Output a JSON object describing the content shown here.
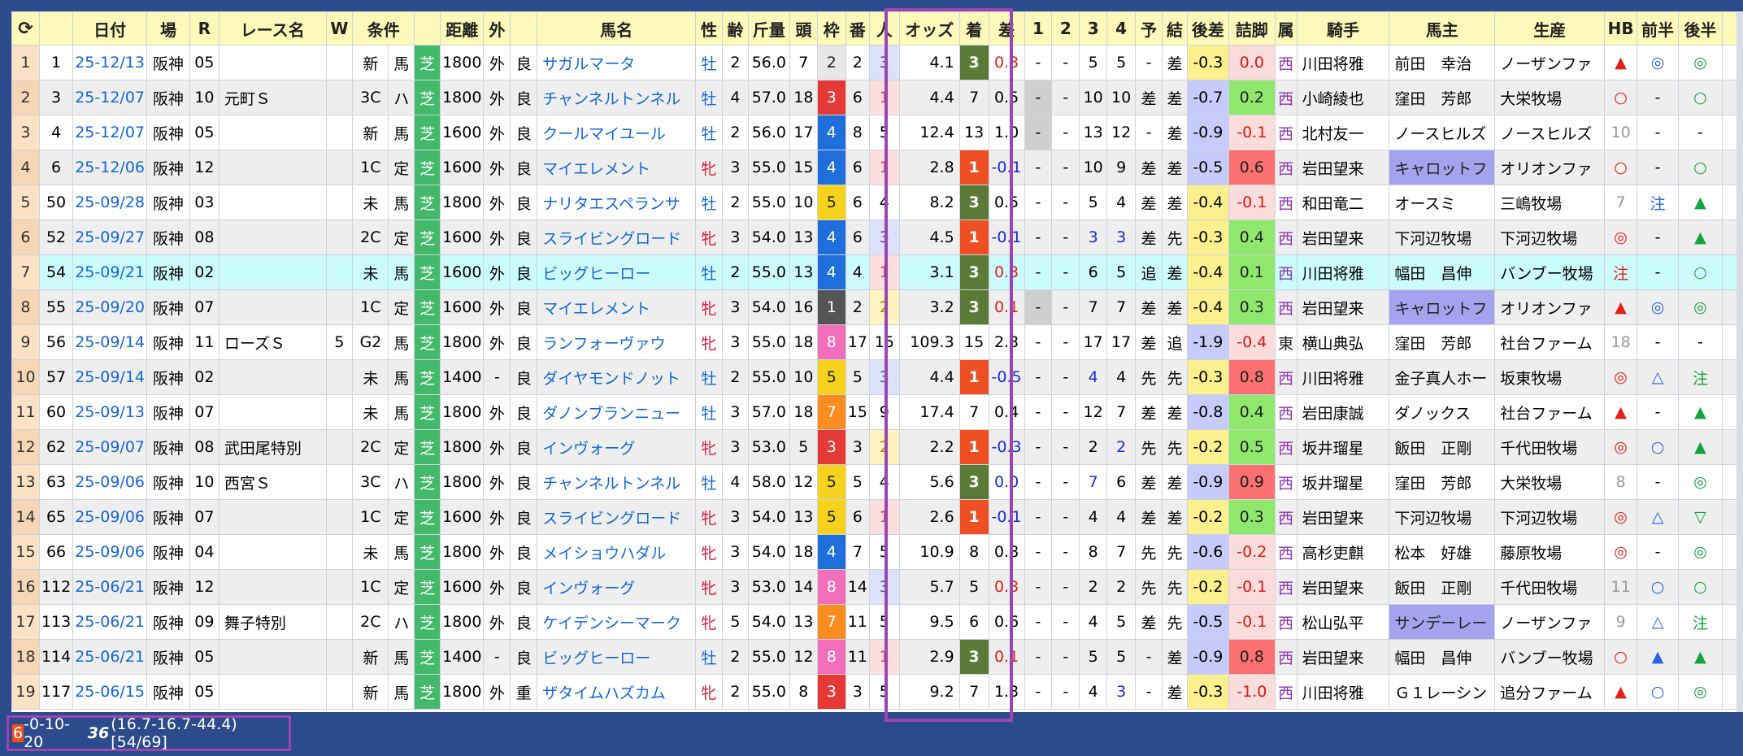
{
  "headers": [
    "",
    "日付",
    "場",
    "R",
    "レース名",
    "W",
    "条件",
    "",
    "",
    "距離",
    "外",
    "",
    "馬名",
    "性",
    "齢",
    "斤量",
    "頭",
    "枠",
    "番",
    "人",
    "オッズ",
    "着",
    "差",
    "1",
    "2",
    "3",
    "4",
    "予",
    "結",
    "後差",
    "詰脚",
    "属",
    "騎手",
    "馬主",
    "生産",
    "HB",
    "前半",
    "後半"
  ],
  "rows": [
    {
      "no": "1",
      "id": "1",
      "date": "25-12/13",
      "venue": "阪神",
      "r": "05",
      "name": "",
      "w": "",
      "cls": "新",
      "type": "馬",
      "surf": "芝",
      "dist": "1800",
      "course": "外",
      "cond": "良",
      "horse": "サガルマータ",
      "sex": "牡",
      "age": "2",
      "wt": "56.0",
      "heads": "7",
      "frame": "2",
      "num": "2",
      "pop": "3",
      "odds": "4.1",
      "fin": "3",
      "diff": "0.3",
      "c1": "-",
      "c2": "-",
      "c3": "5",
      "c4": "5",
      "pred": "-",
      "res": "差",
      "late": "-0.3",
      "sprint": "0.0",
      "aff": "西",
      "jockey": "川田将雅",
      "owner": "前田　幸治",
      "breeder": "ノーザンファ",
      "hb": "▲",
      "fh": "◎",
      "sh": "◎"
    },
    {
      "no": "2",
      "id": "3",
      "date": "25-12/07",
      "venue": "阪神",
      "r": "10",
      "name": "元町Ｓ",
      "w": "",
      "cls": "3C",
      "type": "ハ",
      "surf": "芝",
      "dist": "1800",
      "course": "外",
      "cond": "良",
      "horse": "チャンネルトンネル",
      "sex": "牡",
      "age": "4",
      "wt": "57.0",
      "heads": "18",
      "frame": "3",
      "num": "6",
      "pop": "1",
      "odds": "4.4",
      "fin": "7",
      "diff": "0.5",
      "c1": "-",
      "c2": "-",
      "c3": "10",
      "c4": "10",
      "pred": "差",
      "res": "差",
      "late": "-0.7",
      "sprint": "0.2",
      "aff": "西",
      "jockey": "小崎綾也",
      "owner": "窪田　芳郎",
      "breeder": "大栄牧場",
      "hb": "○",
      "fh": "-",
      "sh": "○"
    },
    {
      "no": "3",
      "id": "4",
      "date": "25-12/07",
      "venue": "阪神",
      "r": "05",
      "name": "",
      "w": "",
      "cls": "新",
      "type": "馬",
      "surf": "芝",
      "dist": "1600",
      "course": "外",
      "cond": "良",
      "horse": "クールマイユール",
      "sex": "牡",
      "age": "2",
      "wt": "56.0",
      "heads": "17",
      "frame": "4",
      "num": "8",
      "pop": "5",
      "odds": "12.4",
      "fin": "13",
      "diff": "1.0",
      "c1": "-",
      "c2": "-",
      "c3": "13",
      "c4": "12",
      "pred": "-",
      "res": "差",
      "late": "-0.9",
      "sprint": "-0.1",
      "aff": "西",
      "jockey": "北村友一",
      "owner": "ノースヒルズ",
      "breeder": "ノースヒルズ",
      "hb": "10",
      "fh": "-",
      "sh": "-"
    },
    {
      "no": "4",
      "id": "6",
      "date": "25-12/06",
      "venue": "阪神",
      "r": "12",
      "name": "",
      "w": "",
      "cls": "1C",
      "type": "定",
      "surf": "芝",
      "dist": "1600",
      "course": "外",
      "cond": "良",
      "horse": "マイエレメント",
      "sex": "牝",
      "age": "3",
      "wt": "55.0",
      "heads": "15",
      "frame": "4",
      "num": "6",
      "pop": "1",
      "odds": "2.8",
      "fin": "1",
      "diff": "-0.1",
      "c1": "-",
      "c2": "-",
      "c3": "10",
      "c4": "9",
      "pred": "差",
      "res": "差",
      "late": "-0.5",
      "sprint": "0.6",
      "aff": "西",
      "jockey": "岩田望来",
      "owner": "キャロットフ",
      "breeder": "オリオンファ",
      "hb": "○",
      "fh": "-",
      "sh": "○"
    },
    {
      "no": "5",
      "id": "50",
      "date": "25-09/28",
      "venue": "阪神",
      "r": "03",
      "name": "",
      "w": "",
      "cls": "未",
      "type": "馬",
      "surf": "芝",
      "dist": "1800",
      "course": "外",
      "cond": "良",
      "horse": "ナリタエスペランサ",
      "sex": "牡",
      "age": "2",
      "wt": "55.0",
      "heads": "10",
      "frame": "5",
      "num": "6",
      "pop": "4",
      "odds": "8.2",
      "fin": "3",
      "diff": "0.5",
      "c1": "-",
      "c2": "-",
      "c3": "5",
      "c4": "4",
      "pred": "差",
      "res": "差",
      "late": "-0.4",
      "sprint": "-0.1",
      "aff": "西",
      "jockey": "和田竜二",
      "owner": "オースミ",
      "breeder": "三嶋牧場",
      "hb": "7",
      "fh": "注",
      "sh": "▲"
    },
    {
      "no": "6",
      "id": "52",
      "date": "25-09/27",
      "venue": "阪神",
      "r": "08",
      "name": "",
      "w": "",
      "cls": "2C",
      "type": "定",
      "surf": "芝",
      "dist": "1600",
      "course": "外",
      "cond": "良",
      "horse": "スライビングロード",
      "sex": "牝",
      "age": "3",
      "wt": "54.0",
      "heads": "13",
      "frame": "4",
      "num": "6",
      "pop": "3",
      "odds": "4.5",
      "fin": "1",
      "diff": "-0.1",
      "c1": "-",
      "c2": "-",
      "c3": "3",
      "c4": "3",
      "pred": "差",
      "res": "先",
      "late": "-0.3",
      "sprint": "0.4",
      "aff": "西",
      "jockey": "岩田望来",
      "owner": "下河辺牧場",
      "breeder": "下河辺牧場",
      "hb": "◎",
      "fh": "-",
      "sh": "▲"
    },
    {
      "no": "7",
      "id": "54",
      "date": "25-09/21",
      "venue": "阪神",
      "r": "02",
      "name": "",
      "w": "",
      "cls": "未",
      "type": "馬",
      "surf": "芝",
      "dist": "1600",
      "course": "外",
      "cond": "良",
      "horse": "ビッグヒーロー",
      "sex": "牡",
      "age": "2",
      "wt": "55.0",
      "heads": "13",
      "frame": "4",
      "num": "4",
      "pop": "1",
      "odds": "3.1",
      "fin": "3",
      "diff": "0.3",
      "c1": "-",
      "c2": "-",
      "c3": "6",
      "c4": "5",
      "pred": "追",
      "res": "差",
      "late": "-0.4",
      "sprint": "0.1",
      "aff": "西",
      "jockey": "川田将雅",
      "owner": "幅田　昌伸",
      "breeder": "バンブー牧場",
      "hb": "注",
      "fh": "-",
      "sh": "○"
    },
    {
      "no": "8",
      "id": "55",
      "date": "25-09/20",
      "venue": "阪神",
      "r": "07",
      "name": "",
      "w": "",
      "cls": "1C",
      "type": "定",
      "surf": "芝",
      "dist": "1600",
      "course": "外",
      "cond": "良",
      "horse": "マイエレメント",
      "sex": "牝",
      "age": "3",
      "wt": "54.0",
      "heads": "16",
      "frame": "1",
      "num": "2",
      "pop": "2",
      "odds": "3.2",
      "fin": "3",
      "diff": "0.1",
      "c1": "-",
      "c2": "-",
      "c3": "7",
      "c4": "7",
      "pred": "差",
      "res": "差",
      "late": "-0.4",
      "sprint": "0.3",
      "aff": "西",
      "jockey": "岩田望来",
      "owner": "キャロットフ",
      "breeder": "オリオンファ",
      "hb": "▲",
      "fh": "◎",
      "sh": "◎"
    },
    {
      "no": "9",
      "id": "56",
      "date": "25-09/14",
      "venue": "阪神",
      "r": "11",
      "name": "ローズＳ",
      "w": "5",
      "cls": "G2",
      "type": "馬",
      "surf": "芝",
      "dist": "1800",
      "course": "外",
      "cond": "良",
      "horse": "ランフォーヴァウ",
      "sex": "牝",
      "age": "3",
      "wt": "55.0",
      "heads": "18",
      "frame": "8",
      "num": "17",
      "pop": "15",
      "odds": "109.3",
      "fin": "15",
      "diff": "2.3",
      "c1": "-",
      "c2": "-",
      "c3": "17",
      "c4": "17",
      "pred": "差",
      "res": "追",
      "late": "-1.9",
      "sprint": "-0.4",
      "aff": "東",
      "jockey": "横山典弘",
      "owner": "窪田　芳郎",
      "breeder": "社台ファーム",
      "hb": "18",
      "fh": "-",
      "sh": "-"
    },
    {
      "no": "10",
      "id": "57",
      "date": "25-09/14",
      "venue": "阪神",
      "r": "02",
      "name": "",
      "w": "",
      "cls": "未",
      "type": "馬",
      "surf": "芝",
      "dist": "1400",
      "course": "-",
      "cond": "良",
      "horse": "ダイヤモンドノット",
      "sex": "牡",
      "age": "2",
      "wt": "55.0",
      "heads": "10",
      "frame": "5",
      "num": "5",
      "pop": "3",
      "odds": "4.4",
      "fin": "1",
      "diff": "-0.5",
      "c1": "-",
      "c2": "-",
      "c3": "4",
      "c4": "4",
      "pred": "先",
      "res": "先",
      "late": "-0.3",
      "sprint": "0.8",
      "aff": "西",
      "jockey": "川田将雅",
      "owner": "金子真人ホー",
      "breeder": "坂東牧場",
      "hb": "◎",
      "fh": "△",
      "sh": "注"
    },
    {
      "no": "11",
      "id": "60",
      "date": "25-09/13",
      "venue": "阪神",
      "r": "07",
      "name": "",
      "w": "",
      "cls": "未",
      "type": "馬",
      "surf": "芝",
      "dist": "1800",
      "course": "外",
      "cond": "良",
      "horse": "ダノンブランニュー",
      "sex": "牡",
      "age": "3",
      "wt": "57.0",
      "heads": "18",
      "frame": "7",
      "num": "15",
      "pop": "9",
      "odds": "17.4",
      "fin": "7",
      "diff": "0.4",
      "c1": "-",
      "c2": "-",
      "c3": "12",
      "c4": "7",
      "pred": "差",
      "res": "差",
      "late": "-0.8",
      "sprint": "0.4",
      "aff": "西",
      "jockey": "岩田康誠",
      "owner": "ダノックス",
      "breeder": "社台ファーム",
      "hb": "▲",
      "fh": "-",
      "sh": "▲"
    },
    {
      "no": "12",
      "id": "62",
      "date": "25-09/07",
      "venue": "阪神",
      "r": "08",
      "name": "武田尾特別",
      "w": "",
      "cls": "2C",
      "type": "定",
      "surf": "芝",
      "dist": "1800",
      "course": "外",
      "cond": "良",
      "horse": "インヴォーグ",
      "sex": "牝",
      "age": "3",
      "wt": "53.0",
      "heads": "5",
      "frame": "3",
      "num": "3",
      "pop": "2",
      "odds": "2.2",
      "fin": "1",
      "diff": "-0.3",
      "c1": "-",
      "c2": "-",
      "c3": "2",
      "c4": "2",
      "pred": "先",
      "res": "先",
      "late": "-0.2",
      "sprint": "0.5",
      "aff": "西",
      "jockey": "坂井瑠星",
      "owner": "飯田　正剛",
      "breeder": "千代田牧場",
      "hb": "◎",
      "fh": "○",
      "sh": "▲"
    },
    {
      "no": "13",
      "id": "63",
      "date": "25-09/06",
      "venue": "阪神",
      "r": "10",
      "name": "西宮Ｓ",
      "w": "",
      "cls": "3C",
      "type": "ハ",
      "surf": "芝",
      "dist": "1800",
      "course": "外",
      "cond": "良",
      "horse": "チャンネルトンネル",
      "sex": "牡",
      "age": "4",
      "wt": "58.0",
      "heads": "12",
      "frame": "5",
      "num": "5",
      "pop": "4",
      "odds": "5.6",
      "fin": "3",
      "diff": "0.0",
      "c1": "-",
      "c2": "-",
      "c3": "7",
      "c4": "6",
      "pred": "差",
      "res": "差",
      "late": "-0.9",
      "sprint": "0.9",
      "aff": "西",
      "jockey": "坂井瑠星",
      "owner": "窪田　芳郎",
      "breeder": "大栄牧場",
      "hb": "8",
      "fh": "-",
      "sh": "◎"
    },
    {
      "no": "14",
      "id": "65",
      "date": "25-09/06",
      "venue": "阪神",
      "r": "07",
      "name": "",
      "w": "",
      "cls": "1C",
      "type": "定",
      "surf": "芝",
      "dist": "1600",
      "course": "外",
      "cond": "良",
      "horse": "スライビングロード",
      "sex": "牝",
      "age": "3",
      "wt": "54.0",
      "heads": "13",
      "frame": "5",
      "num": "6",
      "pop": "1",
      "odds": "2.6",
      "fin": "1",
      "diff": "-0.1",
      "c1": "-",
      "c2": "-",
      "c3": "4",
      "c4": "4",
      "pred": "差",
      "res": "差",
      "late": "-0.2",
      "sprint": "0.3",
      "aff": "西",
      "jockey": "岩田望来",
      "owner": "下河辺牧場",
      "breeder": "下河辺牧場",
      "hb": "◎",
      "fh": "△",
      "sh": "▽"
    },
    {
      "no": "15",
      "id": "66",
      "date": "25-09/06",
      "venue": "阪神",
      "r": "04",
      "name": "",
      "w": "",
      "cls": "未",
      "type": "馬",
      "surf": "芝",
      "dist": "1800",
      "course": "外",
      "cond": "良",
      "horse": "メイショウハダル",
      "sex": "牝",
      "age": "3",
      "wt": "54.0",
      "heads": "18",
      "frame": "4",
      "num": "7",
      "pop": "5",
      "odds": "10.9",
      "fin": "8",
      "diff": "0.8",
      "c1": "-",
      "c2": "-",
      "c3": "8",
      "c4": "7",
      "pred": "先",
      "res": "先",
      "late": "-0.6",
      "sprint": "-0.2",
      "aff": "西",
      "jockey": "高杉吏麒",
      "owner": "松本　好雄",
      "breeder": "藤原牧場",
      "hb": "◎",
      "fh": "-",
      "sh": "◎"
    },
    {
      "no": "16",
      "id": "112",
      "date": "25-06/21",
      "venue": "阪神",
      "r": "12",
      "name": "",
      "w": "",
      "cls": "1C",
      "type": "定",
      "surf": "芝",
      "dist": "1600",
      "course": "外",
      "cond": "良",
      "horse": "インヴォーグ",
      "sex": "牝",
      "age": "3",
      "wt": "53.0",
      "heads": "14",
      "frame": "8",
      "num": "14",
      "pop": "3",
      "odds": "5.7",
      "fin": "5",
      "diff": "0.3",
      "c1": "-",
      "c2": "-",
      "c3": "2",
      "c4": "2",
      "pred": "先",
      "res": "先",
      "late": "-0.2",
      "sprint": "-0.1",
      "aff": "西",
      "jockey": "岩田望来",
      "owner": "飯田　正剛",
      "breeder": "千代田牧場",
      "hb": "11",
      "fh": "○",
      "sh": "○"
    },
    {
      "no": "17",
      "id": "113",
      "date": "25-06/21",
      "venue": "阪神",
      "r": "09",
      "name": "舞子特別",
      "w": "",
      "cls": "2C",
      "type": "ハ",
      "surf": "芝",
      "dist": "1800",
      "course": "外",
      "cond": "良",
      "horse": "ケイデンシーマーク",
      "sex": "牝",
      "age": "5",
      "wt": "54.0",
      "heads": "13",
      "frame": "7",
      "num": "11",
      "pop": "5",
      "odds": "9.5",
      "fin": "6",
      "diff": "0.6",
      "c1": "-",
      "c2": "-",
      "c3": "4",
      "c4": "5",
      "pred": "差",
      "res": "先",
      "late": "-0.5",
      "sprint": "-0.1",
      "aff": "西",
      "jockey": "松山弘平",
      "owner": "サンデーレー",
      "breeder": "ノーザンファ",
      "hb": "9",
      "fh": "△",
      "sh": "注"
    },
    {
      "no": "18",
      "id": "114",
      "date": "25-06/21",
      "venue": "阪神",
      "r": "05",
      "name": "",
      "w": "",
      "cls": "新",
      "type": "馬",
      "surf": "芝",
      "dist": "1400",
      "course": "-",
      "cond": "良",
      "horse": "ビッグヒーロー",
      "sex": "牡",
      "age": "2",
      "wt": "55.0",
      "heads": "12",
      "frame": "8",
      "num": "11",
      "pop": "1",
      "odds": "2.9",
      "fin": "3",
      "diff": "0.1",
      "c1": "-",
      "c2": "-",
      "c3": "5",
      "c4": "5",
      "pred": "-",
      "res": "差",
      "late": "-0.9",
      "sprint": "0.8",
      "aff": "西",
      "jockey": "岩田望来",
      "owner": "幅田　昌伸",
      "breeder": "バンブー牧場",
      "hb": "○",
      "fh": "▲",
      "sh": "▲"
    },
    {
      "no": "19",
      "id": "117",
      "date": "25-06/15",
      "venue": "阪神",
      "r": "05",
      "name": "",
      "w": "",
      "cls": "新",
      "type": "馬",
      "surf": "芝",
      "dist": "1800",
      "course": "外",
      "cond": "重",
      "horse": "ザタイムハズカム",
      "sex": "牝",
      "age": "2",
      "wt": "55.0",
      "heads": "8",
      "frame": "3",
      "num": "3",
      "pop": "5",
      "odds": "9.2",
      "fin": "7",
      "diff": "1.3",
      "c1": "-",
      "c2": "-",
      "c3": "4",
      "c4": "3",
      "pred": "-",
      "res": "差",
      "late": "-0.3",
      "sprint": "-1.0",
      "aff": "西",
      "jockey": "川田将雅",
      "owner": "Ｇ１レーシン",
      "breeder": "追分ファーム",
      "hb": "▲",
      "fh": "○",
      "sh": "◎"
    }
  ],
  "footer": {
    "first": "6",
    "record": "-0-10-20",
    "bold": "36",
    "rest": "(16.7-16.7-44.4) [54/69]"
  },
  "colors": {
    "accent": "#9b45b0",
    "turf": "#43b96b",
    "header": "#fdf9b8",
    "win": "#f04e23",
    "show": "#5b7a38"
  }
}
